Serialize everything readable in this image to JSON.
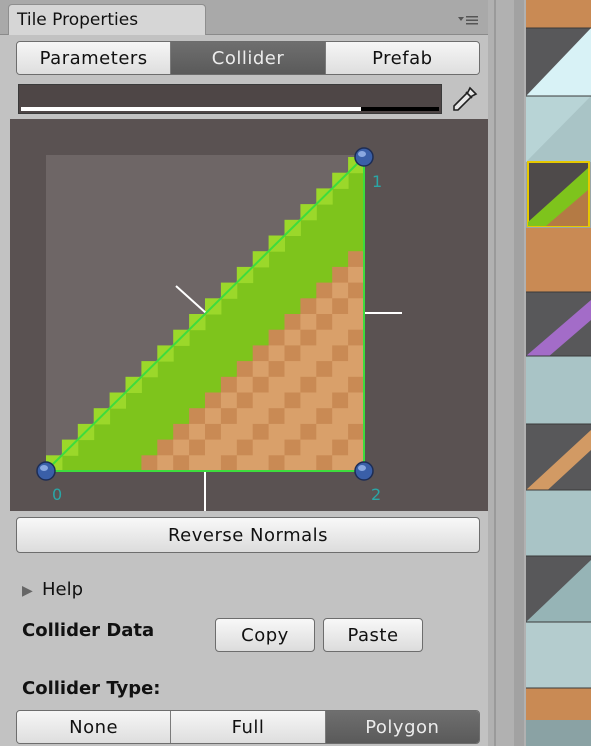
{
  "window": {
    "tab_title": "Tile Properties",
    "menu_icon": "panel-menu-icon"
  },
  "modes": {
    "items": [
      "Parameters",
      "Collider",
      "Prefab"
    ],
    "selected": "Collider"
  },
  "color_field": {
    "icon": "eyedropper-icon",
    "alpha": 0.82
  },
  "collider_preview": {
    "vertex_labels": [
      "0",
      "1",
      "2"
    ],
    "colors": {
      "grass": "#7ec41c",
      "grass_light": "#9bd82a",
      "dirt": "#c98a54",
      "dirt_light": "#d9a06a",
      "edge": "#3ddc3d",
      "handle": "#3a5fa8",
      "label": "#2aa6a6"
    }
  },
  "reverse_normals_label": "Reverse Normals",
  "help": {
    "label": "Help",
    "icon": "triangle-right-icon"
  },
  "collider_data": {
    "label": "Collider Data",
    "copy_label": "Copy",
    "paste_label": "Paste"
  },
  "collider_type": {
    "label": "Collider Type:",
    "options": [
      "None",
      "Full",
      "Polygon"
    ],
    "selected": "Polygon"
  }
}
